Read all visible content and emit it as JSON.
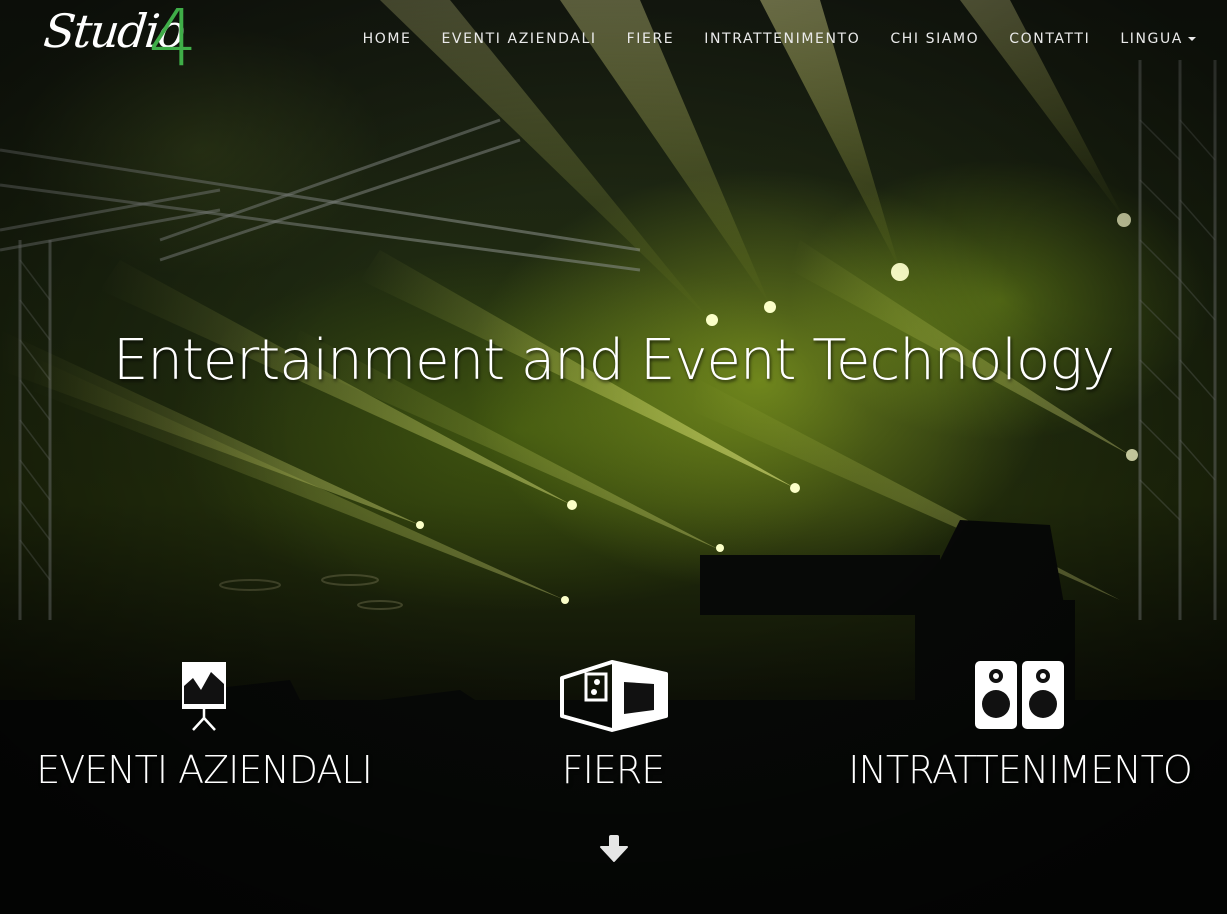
{
  "brand": {
    "logo_text": "Studio",
    "logo_number": "4",
    "logo_color": "#3fae48"
  },
  "nav": {
    "items": [
      {
        "label": "HOME"
      },
      {
        "label": "EVENTI AZIENDALI"
      },
      {
        "label": "FIERE"
      },
      {
        "label": "INTRATTENIMENTO"
      },
      {
        "label": "CHI SIAMO"
      },
      {
        "label": "CONTATTI"
      },
      {
        "label": "LINGUA"
      }
    ]
  },
  "hero": {
    "title": "Entertainment and Event Technology",
    "background": "concert stage with yellow-green lighting beams"
  },
  "services": [
    {
      "label": "EVENTI AZIENDALI",
      "icon": "presentation-board-icon"
    },
    {
      "label": "FIERE",
      "icon": "trade-booth-icon"
    },
    {
      "label": "INTRATTENIMENTO",
      "icon": "speakers-icon"
    }
  ],
  "scroll": {
    "icon": "arrow-down-icon"
  }
}
